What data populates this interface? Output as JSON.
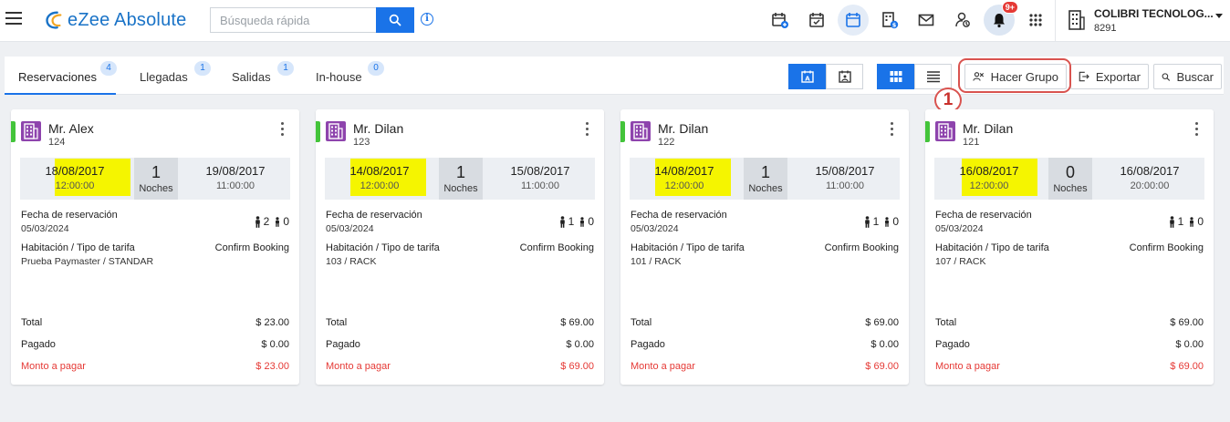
{
  "app": {
    "name": "eZee Absolute"
  },
  "search": {
    "placeholder": "Búsqueda rápida"
  },
  "header": {
    "icons": [
      "calendar-add-icon",
      "calendar-check-icon",
      "calendar-icon",
      "building-dollar-icon",
      "mail-icon",
      "handshake-icon",
      "bell-icon",
      "apps-grid-icon"
    ],
    "notification_badge": "9+",
    "company_name": "COLIBRI TECNOLOG...",
    "company_id": "8291"
  },
  "tabs": [
    {
      "label": "Reservaciones",
      "count": "4",
      "active": true
    },
    {
      "label": "Llegadas",
      "count": "1"
    },
    {
      "label": "Salidas",
      "count": "1"
    },
    {
      "label": "In-house",
      "count": "0"
    }
  ],
  "actions": {
    "group_label": "Hacer Grupo",
    "export_label": "Exportar",
    "search_label": "Buscar"
  },
  "annotation": {
    "step": "1"
  },
  "labels": {
    "nights": "Noches",
    "booking_date": "Fecha de reservación",
    "room_rate": "Habitación / Tipo de tarifa",
    "total": "Total",
    "paid": "Pagado",
    "due": "Monto a pagar"
  },
  "colors": {
    "accent": "#1a73e8",
    "status_stripe": "#43c43a",
    "highlight": "#f5f500",
    "due": "#e53935"
  },
  "cards": [
    {
      "guest": "Mr. Alex",
      "res_no": "124",
      "arrival_date": "18/08/2017",
      "arrival_time": "12:00:00",
      "nights": "1",
      "departure_date": "19/08/2017",
      "departure_time": "11:00:00",
      "booking_date": "05/03/2024",
      "adults": "2",
      "children": "0",
      "status": "Confirm Booking",
      "room": "Prueba Paymaster / STANDAR",
      "total": "$ 23.00",
      "paid": "$ 0.00",
      "due": "$ 23.00"
    },
    {
      "guest": "Mr. Dilan",
      "res_no": "123",
      "arrival_date": "14/08/2017",
      "arrival_time": "12:00:00",
      "nights": "1",
      "departure_date": "15/08/2017",
      "departure_time": "11:00:00",
      "booking_date": "05/03/2024",
      "adults": "1",
      "children": "0",
      "status": "Confirm Booking",
      "room": "103 / RACK",
      "total": "$ 69.00",
      "paid": "$ 0.00",
      "due": "$ 69.00"
    },
    {
      "guest": "Mr. Dilan",
      "res_no": "122",
      "arrival_date": "14/08/2017",
      "arrival_time": "12:00:00",
      "nights": "1",
      "departure_date": "15/08/2017",
      "departure_time": "11:00:00",
      "booking_date": "05/03/2024",
      "adults": "1",
      "children": "0",
      "status": "Confirm Booking",
      "room": "101 / RACK",
      "total": "$ 69.00",
      "paid": "$ 0.00",
      "due": "$ 69.00"
    },
    {
      "guest": "Mr. Dilan",
      "res_no": "121",
      "arrival_date": "16/08/2017",
      "arrival_time": "12:00:00",
      "nights": "0",
      "departure_date": "16/08/2017",
      "departure_time": "20:00:00",
      "booking_date": "05/03/2024",
      "adults": "1",
      "children": "0",
      "status": "Confirm Booking",
      "room": "107 / RACK",
      "total": "$ 69.00",
      "paid": "$ 0.00",
      "due": "$ 69.00"
    }
  ]
}
